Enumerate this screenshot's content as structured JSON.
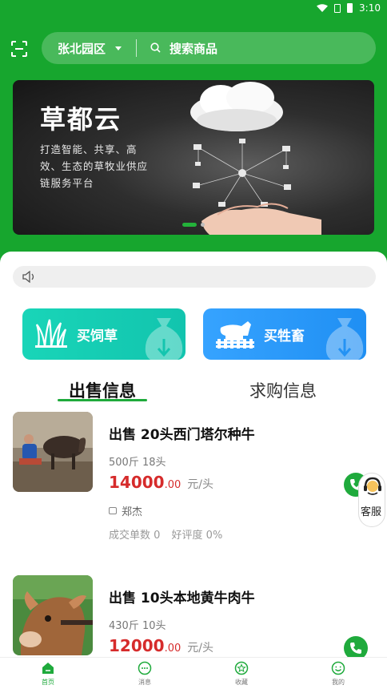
{
  "status_bar": {
    "time": "3:10"
  },
  "header": {
    "location": "张北园区",
    "search_placeholder": "搜索商品"
  },
  "banner": {
    "title": "草都云",
    "subtitle": "打造智能、共享、高效、生态的草牧业供应链服务平台",
    "active_slide": 1,
    "slide_count": 2
  },
  "categories": [
    {
      "label": "买饲草",
      "color": "#19d5b8"
    },
    {
      "label": "买牲畜",
      "color": "#36a3ff"
    }
  ],
  "tabs": {
    "sell": "出售信息",
    "buy": "求购信息",
    "active": "sell"
  },
  "listings": [
    {
      "title": "出售 20头西门塔尔种牛",
      "spec": "500斤 18头",
      "price_int": "14000",
      "price_dec": ".00",
      "unit": "元/头",
      "seller": "郑杰",
      "deals": "成交单数  0",
      "rating": "好评度  0%"
    },
    {
      "title": "出售 10头本地黄牛肉牛",
      "spec": "430斤 10头",
      "price_int": "12000",
      "price_dec": ".00",
      "unit": "元/头"
    }
  ],
  "service": {
    "label": "客服"
  },
  "tabbar": [
    {
      "label": "首页",
      "icon": "home-icon"
    },
    {
      "label": "消息",
      "icon": "message-icon"
    },
    {
      "label": "收藏",
      "icon": "star-icon"
    },
    {
      "label": "我的",
      "icon": "profile-icon"
    }
  ],
  "colors": {
    "brand": "#17a62e",
    "price": "#d62b2b",
    "accent": "#1faa3c"
  }
}
